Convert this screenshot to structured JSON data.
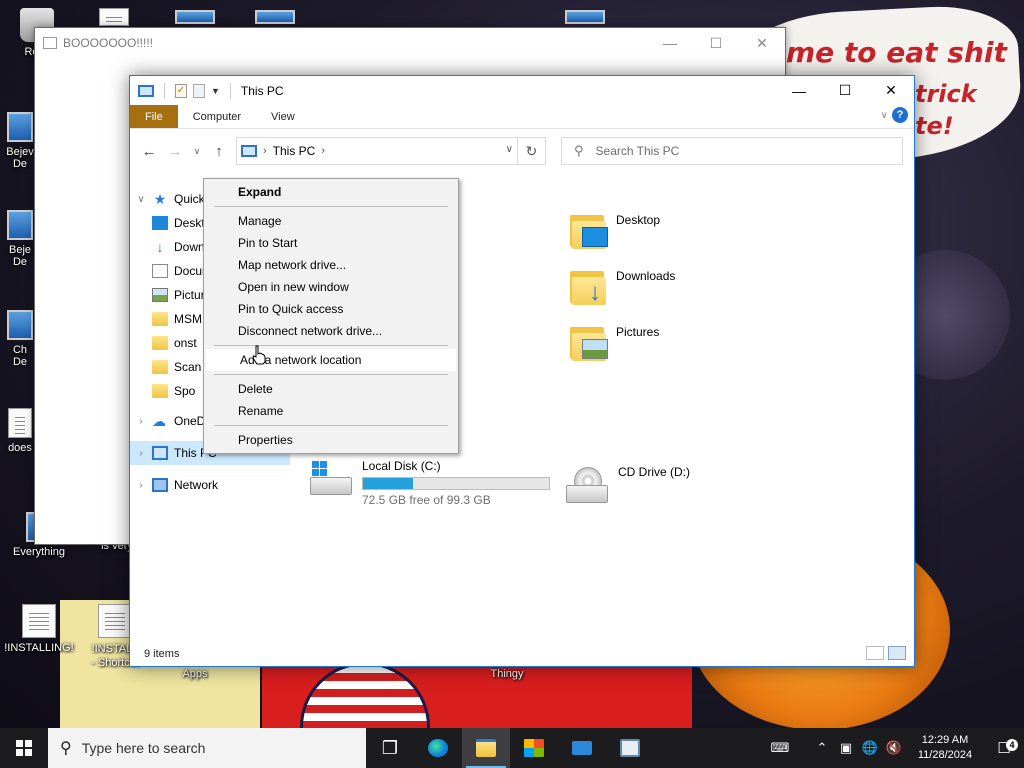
{
  "wallpaper": {
    "line1": "me to eat shit",
    "line2": "trick",
    "line3": "te!",
    "colors": {
      "text": "#c5242b",
      "pumpkin": "#e97b11"
    }
  },
  "desktop_icons": [
    {
      "label": "Recy",
      "icon": "recycle-bin-icon"
    },
    {
      "label": "Bejev\nDe",
      "icon": "shortcut-icon"
    },
    {
      "label": "Beje\nDe",
      "icon": "shortcut-icon"
    },
    {
      "label": "Ch\nDe",
      "icon": "shortcut-icon"
    },
    {
      "label": "does",
      "icon": "shortcut-icon"
    },
    {
      "label": "Everything",
      "icon": "shortcut-icon"
    },
    {
      "label": "is very",
      "icon": "shortcut-icon"
    },
    {
      "label": "!INSTALLING!",
      "icon": "text-file-icon"
    },
    {
      "label": "!INSTALL\n- Shortcut",
      "icon": "text-file-icon"
    },
    {
      "label": "Apps",
      "icon": "folder-icon"
    },
    {
      "label": "Thingy",
      "icon": "shortcut-icon"
    }
  ],
  "back_window": {
    "title": "BOOOOOOO!!!!!"
  },
  "explorer": {
    "title": "This PC",
    "ribbon_tabs": [
      "File",
      "Computer",
      "View"
    ],
    "address": {
      "location": "This PC"
    },
    "search_placeholder": "Search This PC",
    "nav": {
      "quick_access": "Quick access",
      "quick_items": [
        "Desktop",
        "Downloads",
        "Documents",
        "Pictures",
        "MSM",
        "onst",
        "Scan",
        "Spo"
      ],
      "onedrive": "OneDrive",
      "this_pc": "This PC",
      "network": "Network"
    },
    "folders": [
      {
        "label": "Desktop",
        "icon": "desktop-folder-icon"
      },
      {
        "label": "Downloads",
        "icon": "downloads-folder-icon"
      },
      {
        "label": "Pictures",
        "icon": "pictures-folder-icon"
      }
    ],
    "drives": [
      {
        "label": "Local Disk (C:)",
        "free_text": "72.5 GB free of 99.3 GB",
        "used_fraction": 0.27,
        "icon": "local-disk-icon"
      },
      {
        "label": "CD Drive (D:)",
        "icon": "cd-drive-icon"
      }
    ],
    "status": "9 items"
  },
  "context_menu": {
    "items": [
      "Expand",
      "Manage",
      "Pin to Start",
      "Map network drive...",
      "Open in new window",
      "Pin to Quick access",
      "Disconnect network drive...",
      "Add a network location",
      "Delete",
      "Rename",
      "Properties"
    ],
    "hovered": "Add a network location"
  },
  "taskbar": {
    "search_placeholder": "Type here to search",
    "apps": [
      "task-view-icon",
      "edge-icon",
      "file-explorer-icon",
      "store-icon",
      "mail-icon",
      "notepad-app-icon"
    ],
    "time": "12:29 AM",
    "date": "11/28/2024",
    "notification_count": "4"
  }
}
